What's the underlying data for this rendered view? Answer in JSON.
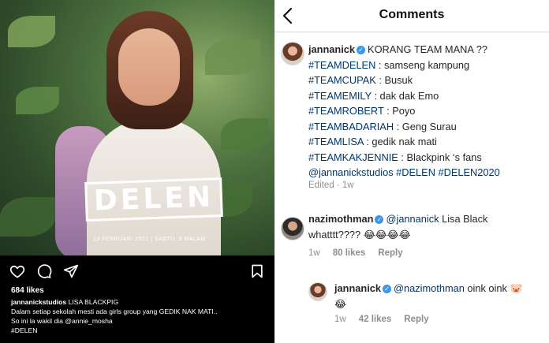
{
  "post": {
    "logo_text": "DELEN",
    "air_date": "13 FEBRUARI 2021  |  SABTU, 9 MALAM",
    "likes": "684 likes",
    "caption_user": "jannanickstudios",
    "caption_first": "LISA BLACKPIG",
    "caption_lines": [
      "Dalam setiap sekolah mesti ada girls group yang GEDIK NAK MATI..",
      "So ini la wakil dia @annie_mosha",
      "#DELEN"
    ]
  },
  "comments_panel": {
    "title": "Comments",
    "main_comment": {
      "username": "jannanick",
      "first_line": "KORANG TEAM MANA ??",
      "teams": [
        {
          "tag": "#TEAMDELEN",
          "text": " : samseng kampung"
        },
        {
          "tag": "#TEAMCUPAK",
          "text": " : Busuk"
        },
        {
          "tag": "#TEAMEMILY",
          "text": " : dak dak Emo"
        },
        {
          "tag": "#TEAMROBERT",
          "text": " : Poyo"
        },
        {
          "tag": "#TEAMBADARIAH",
          "text": " : Geng Surau"
        },
        {
          "tag": "#TEAMLISA",
          "text": " : gedik nak mati"
        },
        {
          "tag": "#TEAMKAKJENNIE",
          "text": " : Blackpink ‘s fans"
        }
      ],
      "last_line": "@jannanickstudios #DELEN #DELEN2020",
      "meta_edited": "Edited",
      "meta_sep": " · ",
      "meta_time": "1w"
    },
    "reply_1": {
      "username": "nazimothman",
      "mention": "@jannanick",
      "text_a": " Lisa Black",
      "text_b": "whatttt???? ",
      "emoji": "😂😂😂😂",
      "time": "1w",
      "likes": "80 likes",
      "reply_label": "Reply"
    },
    "reply_2": {
      "username": "jannanick",
      "mention": "@nazimothman",
      "text_a": " oink oink ",
      "emoji_pig": "🐷",
      "emoji_b": "😂",
      "time": "1w",
      "likes": "42 likes",
      "reply_label": "Reply"
    }
  },
  "icons": {
    "verified": "verified-badge-icon",
    "verified_glyph": "✓"
  }
}
